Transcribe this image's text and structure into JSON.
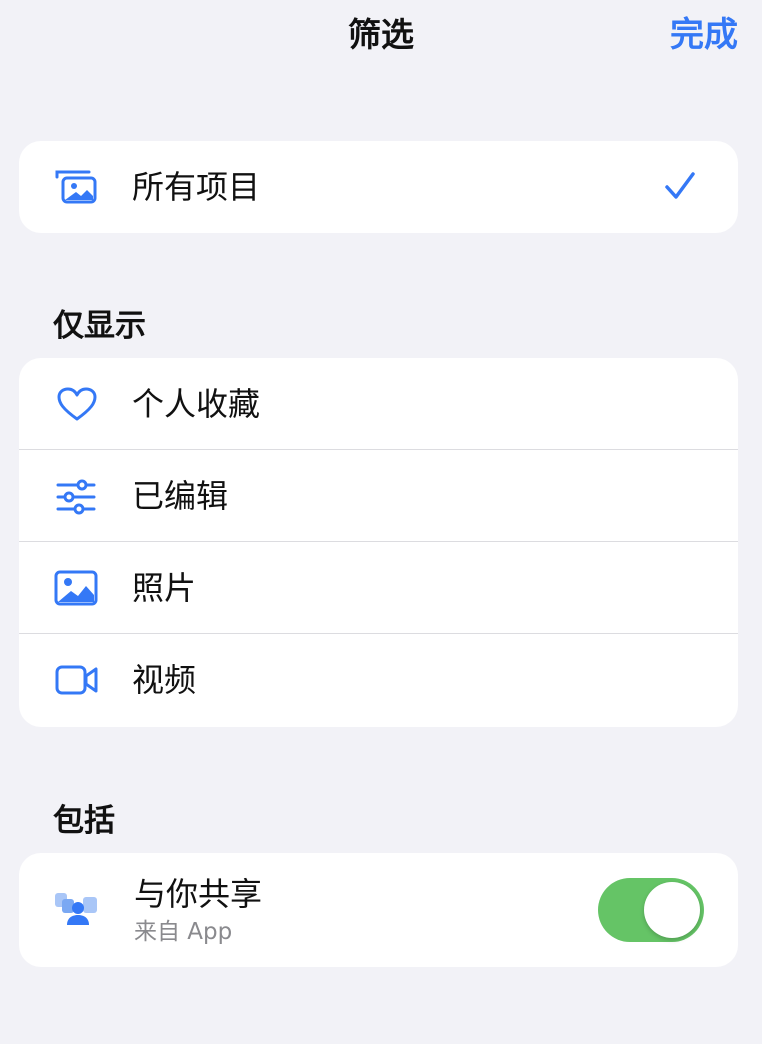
{
  "nav": {
    "title": "筛选",
    "done_label": "完成"
  },
  "all_items": {
    "label": "所有项目",
    "icon": "photo-stack-icon",
    "selected": true
  },
  "only_show": {
    "header": "仅显示",
    "items": [
      {
        "label": "个人收藏",
        "icon": "heart-icon"
      },
      {
        "label": "已编辑",
        "icon": "sliders-icon"
      },
      {
        "label": "照片",
        "icon": "photo-icon"
      },
      {
        "label": "视频",
        "icon": "video-icon"
      }
    ]
  },
  "include": {
    "header": "包括",
    "shared": {
      "title": "与你共享",
      "subtitle": "来自 App",
      "icon": "shared-with-you-icon",
      "toggle_on": true
    }
  },
  "colors": {
    "accent": "#3478f6",
    "toggle_on": "#65c466",
    "background": "#f2f2f7"
  }
}
